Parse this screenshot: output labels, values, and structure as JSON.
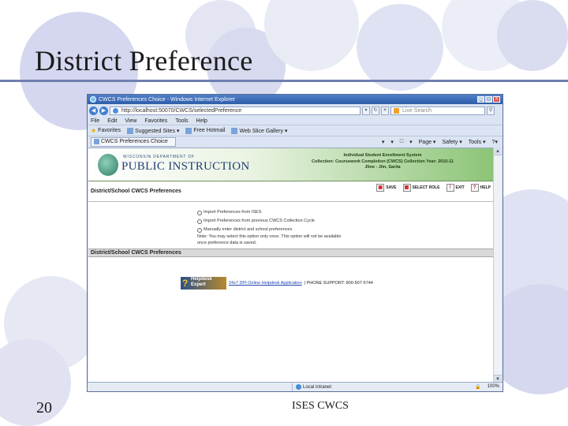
{
  "slide": {
    "title": "District Preference",
    "number": "20",
    "footer": "ISES CWCS"
  },
  "colors": {
    "title_rule": "#6f7fb0",
    "decor_circle": "#c7cbe6",
    "banner_green": "#8cc477",
    "section_gray": "#d9d9d9"
  },
  "browser": {
    "title": "CWCS Preferences Choice - Windows Internet Explorer",
    "window_buttons": [
      "_",
      "□",
      "X"
    ],
    "nav": {
      "back": "◀",
      "forward": "▶"
    },
    "url": "http://localhost:50070/CWCS/selectedPreference",
    "search_placeholder": "Live Search",
    "menu": [
      "File",
      "Edit",
      "View",
      "Favorites",
      "Tools",
      "Help"
    ],
    "favorites_bar": {
      "favorites_label": "Favorites",
      "items": [
        "Suggested Sites ▾",
        "Free Hotmail",
        "Web Slice Gallery ▾"
      ]
    },
    "tab_label": "CWCS Preferences Choice",
    "command_bar": [
      "▾",
      "▾",
      "□",
      "▾",
      "Page ▾",
      "Safety ▾",
      "Tools ▾",
      "?▾"
    ],
    "status": {
      "zone": "Local intranet",
      "zoom": "100%",
      "protected": "🔒"
    }
  },
  "page": {
    "logo_small": "WISCONSIN DEPARTMENT OF",
    "logo_big": "PUBLIC INSTRUCTION",
    "banner_lines": [
      "Individual Student Enrollment System",
      "Collection: Coursework Completion (CWCS)    Collection Year: 2010-11",
      "Jline - Jlin, Sarita"
    ],
    "section1_title": "District/School CWCS Preferences",
    "actions": [
      {
        "icon": "▣",
        "label": "SAVE"
      },
      {
        "icon": "▦",
        "label": "SELECT ROLE"
      },
      {
        "icon": "!",
        "label": "EXIT"
      },
      {
        "icon": "?",
        "label": "HELP"
      }
    ],
    "options": [
      "Import Preferences from ISES",
      "Import Preferences from previous CWCS Collection Cycle",
      "Manually enter district and school preferences"
    ],
    "note_line1": "Note: You may select this option only once. This option will not be available",
    "note_line2": "once preference data is saved.",
    "section2_title": "District/School CWCS Preferences",
    "help_logo_line1": "Helpdesk",
    "help_logo_line2": "Expert",
    "help_link": "24x7 DPI Online Helpdesk Application",
    "help_support": "| PHONE SUPPORT: 800-507-5744"
  }
}
